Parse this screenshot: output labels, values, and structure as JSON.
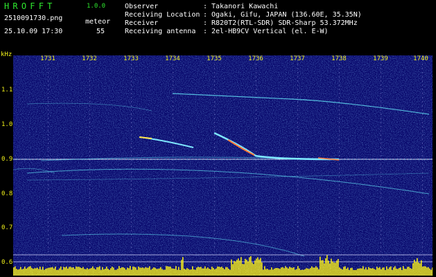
{
  "app": {
    "title": "HROFFT",
    "version": "1.0.0"
  },
  "file": {
    "name": "2510091730.png",
    "datetime": "25.10.09 17:30"
  },
  "event": {
    "label": "meteor",
    "count": "55"
  },
  "station": {
    "separator": ":",
    "rows": [
      {
        "label": "Observer",
        "value": "Takanori Kawachi"
      },
      {
        "label": "Receiving Location",
        "value": "Ogaki, Gifu, JAPAN (136.60E, 35.35N)"
      },
      {
        "label": "Receiver",
        "value": "R820T2(RTL-SDR) SDR-Sharp 53.372MHz"
      },
      {
        "label": "Receiving antenna",
        "value": "2el-HB9CV Vertical (el. E-W)"
      }
    ]
  },
  "axis": {
    "unit": "kHz",
    "y_ticks": [
      "1.1",
      "1.0",
      "0.9",
      "0.8",
      "0.7",
      "0.6"
    ],
    "x_ticks": [
      "1731",
      "1732",
      "1733",
      "1734",
      "1735",
      "1736",
      "1737",
      "1738",
      "1739",
      "1740"
    ]
  },
  "colors": {
    "header_green": "#2ee82e",
    "header_white": "#ffffff",
    "axis_yellow": "#f2f21a",
    "spectrogram_background": "#0a0a6e",
    "power_bars": "#f2e81a",
    "signal_cyan": "#5fd8f0"
  }
}
